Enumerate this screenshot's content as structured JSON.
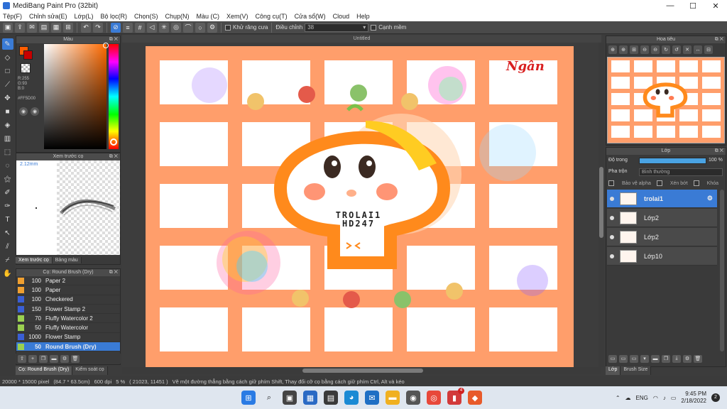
{
  "title": "MediBang Paint Pro (32bit)",
  "window_buttons": [
    "—",
    "☐",
    "✕"
  ],
  "menu": [
    "Tệp(F)",
    "Chỉnh sửa(E)",
    "Lớp(L)",
    "Bộ lọc(R)",
    "Chọn(S)",
    "Chụp(N)",
    "Màu (C)",
    "Xem(V)",
    "Công cụ(T)",
    "Cửa sổ(W)",
    "Cloud",
    "Help"
  ],
  "toolbar": {
    "antialias_label": "Khử răng cưa",
    "adjust_label": "Điều chỉnh",
    "adjust_value": "38",
    "soft_edge_label": "Cạnh mềm"
  },
  "color_panel": {
    "title": "Màu",
    "rgb": [
      "R:255",
      "G:93",
      "B:0"
    ],
    "hex": "#FF5D00",
    "fg_color": "#ff5d00",
    "bg_color": "#c70000"
  },
  "brush_preview": {
    "title": "Xem trước cọ",
    "size": "2.12mm",
    "tabs": [
      "Xem trước cọ",
      "Bảng màu"
    ]
  },
  "brush_list": {
    "title": "Cọ: Round Brush (Dry)",
    "items": [
      {
        "size": "100",
        "name": "Paper 2",
        "color": "#f0a030"
      },
      {
        "size": "100",
        "name": "Paper",
        "color": "#f0a030"
      },
      {
        "size": "100",
        "name": "Checkered",
        "color": "#3a5fd5"
      },
      {
        "size": "150",
        "name": "Flower Stamp 2",
        "color": "#3a5fd5"
      },
      {
        "size": "70",
        "name": "Fluffy Watercolor 2",
        "color": "#9ad050"
      },
      {
        "size": "50",
        "name": "Fluffy Watercolor",
        "color": "#9ad050"
      },
      {
        "size": "1000",
        "name": "Flower Stamp",
        "color": "#3a5fd5"
      },
      {
        "size": "50",
        "name": "Round Brush (Dry)",
        "color": "#9ad050"
      }
    ],
    "bottom_tabs": [
      "Cọ: Round Brush (Dry)",
      "Kiểm soát cọ"
    ]
  },
  "document": {
    "tab": "Untitled",
    "artwork_text": [
      "TROLAI1",
      "HD247"
    ],
    "signature": "Ngân",
    "bg_color": "#ff9e6b"
  },
  "navigator": {
    "title": "Hoa tiêu",
    "tools": [
      "⊕",
      "⊕",
      "⊞",
      "⊖",
      "⊖",
      "↻",
      "↺",
      "✕",
      "↔",
      "⊟"
    ]
  },
  "layer_panel": {
    "title": "Lớp",
    "opacity_label": "Độ trong",
    "opacity_value": "100 %",
    "opacity_fraction": 1.0,
    "blend_label": "Pha trộn",
    "blend_value": "Bình thường",
    "protect_alpha": "Bảo vệ alpha",
    "clipping": "Xén bớt",
    "lock": "Khóa",
    "layers": [
      "trolai1",
      "Lớp2",
      "Lớp2",
      "Lớp10"
    ],
    "bottom_tabs": [
      "Lớp",
      "Brush Size"
    ]
  },
  "status": {
    "size": "20000 * 15000 pixel",
    "cm": "(84.7 * 63.5cm)",
    "dpi": "600 dpi",
    "zoom": "5 %",
    "coords": "( 21023, 11451 )",
    "hint": "Vẽ một đường thẳng bằng cách giữ phím Shift, Thay đổi cỡ cọ bằng cách giữ phím Ctrl, Alt và kéo"
  },
  "taskbar": {
    "lang": "ENG",
    "time": "9:45 PM",
    "date": "2/18/2022",
    "badge": "4",
    "notif": "2"
  }
}
